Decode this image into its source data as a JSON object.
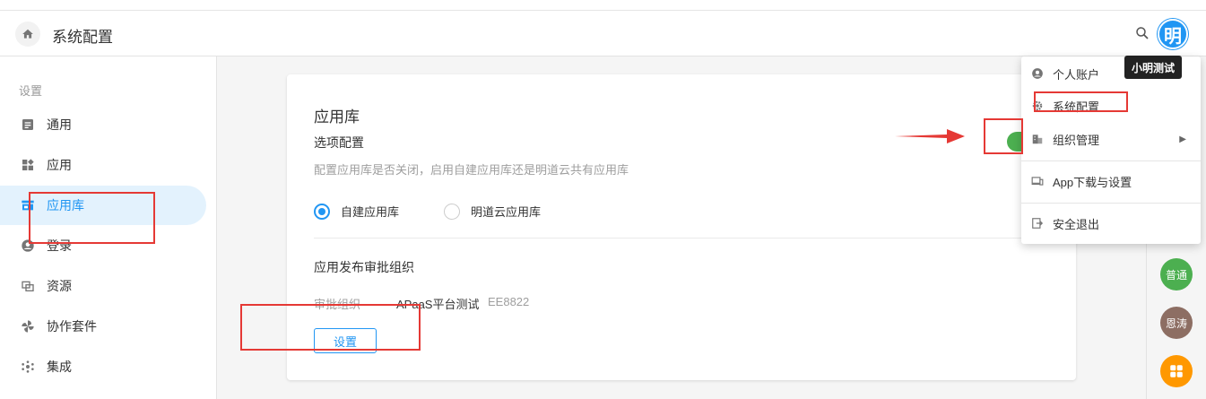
{
  "header": {
    "title": "系统配置",
    "avatar_text": "明",
    "tooltip": "小明测试"
  },
  "sidebar": {
    "section": "设置",
    "items": [
      {
        "label": "通用",
        "icon": "document-icon"
      },
      {
        "label": "应用",
        "icon": "apps-icon"
      },
      {
        "label": "应用库",
        "icon": "store-icon",
        "active": true
      },
      {
        "label": "登录",
        "icon": "user-icon"
      },
      {
        "label": "资源",
        "icon": "resource-icon"
      },
      {
        "label": "协作套件",
        "icon": "pinwheel-icon"
      },
      {
        "label": "集成",
        "icon": "integration-icon"
      }
    ]
  },
  "main": {
    "title": "应用库",
    "option_title": "选项配置",
    "option_desc": "配置应用库是否关闭，启用自建应用库还是明道云共有应用库",
    "radios": [
      {
        "label": "自建应用库",
        "checked": true
      },
      {
        "label": "明道云应用库",
        "checked": false
      }
    ],
    "approval_title": "应用发布审批组织",
    "approval_label": "审批组织",
    "approval_org": "APaaS平台测试",
    "approval_code": "EE8822",
    "set_button": "设置",
    "toggle_on": true
  },
  "user_menu": {
    "items": [
      {
        "label": "个人账户",
        "icon": "account-circle-icon"
      },
      {
        "label": "系统配置",
        "icon": "gear-icon"
      },
      {
        "label": "组织管理",
        "icon": "building-icon",
        "has_submenu": true
      },
      {
        "label": "App下载与设置",
        "icon": "devices-icon"
      },
      {
        "label": "安全退出",
        "icon": "logout-icon"
      }
    ]
  },
  "right_rail": {
    "avatars": [
      {
        "label": "普通",
        "color": "#4caf50"
      },
      {
        "label": "恩涛",
        "color": "#8d6e63"
      }
    ],
    "apps_color": "#ff9800"
  },
  "colors": {
    "accent": "#2196f3",
    "annotation": "#e53935",
    "toggle": "#4caf50"
  }
}
